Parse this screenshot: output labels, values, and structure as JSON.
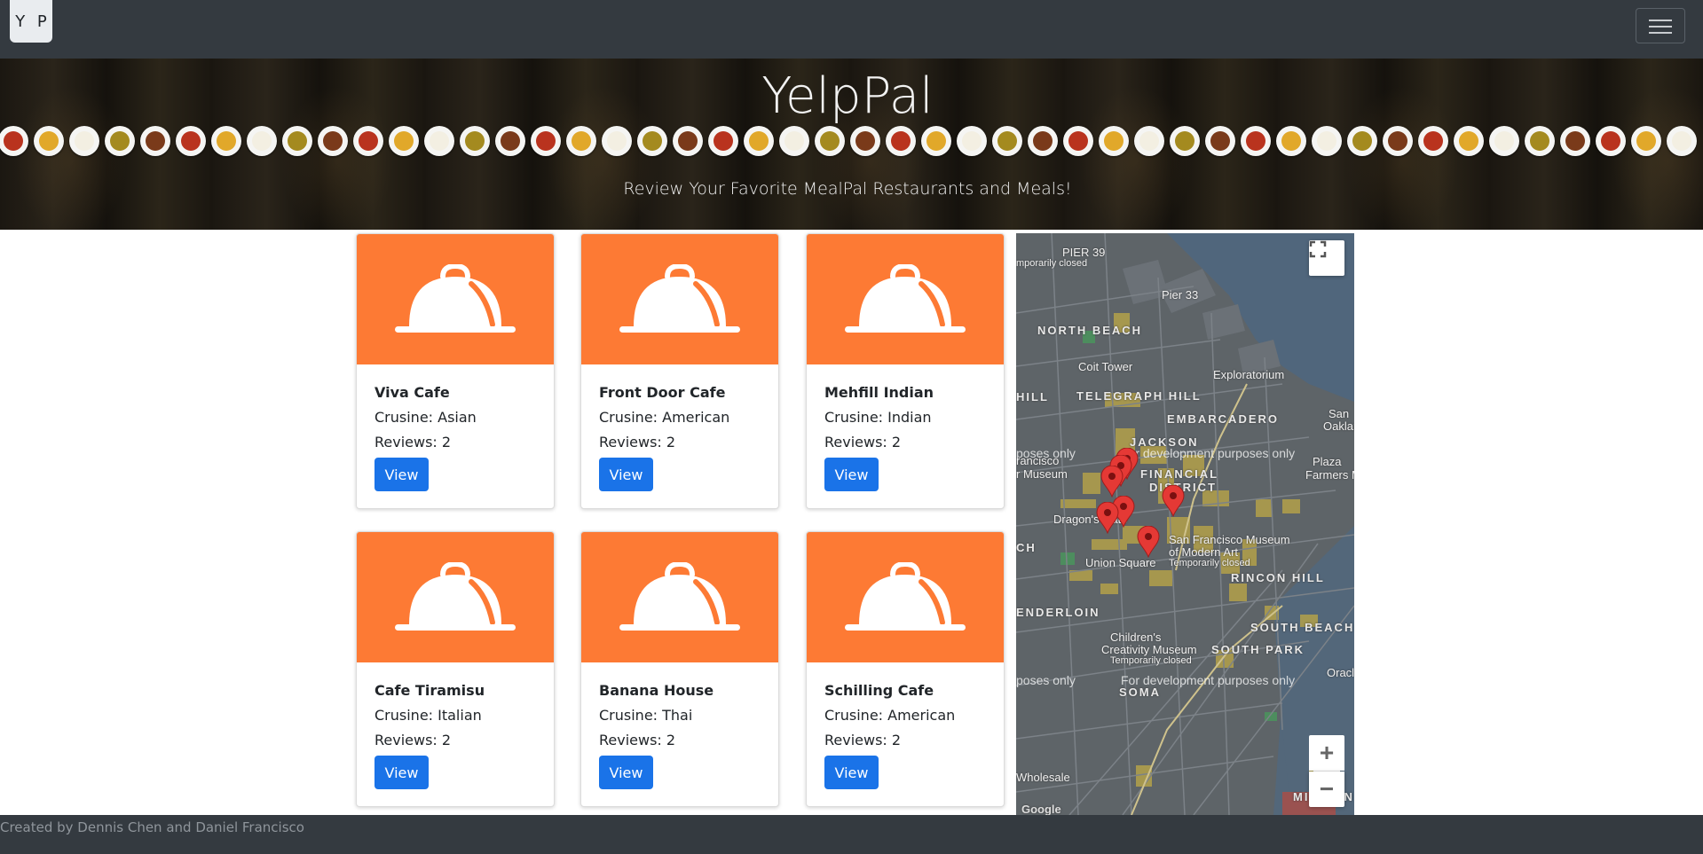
{
  "navbar": {
    "brand": "Y P"
  },
  "hero": {
    "title": "YelpPal",
    "subtitle": "Review Your Favorite MealPal Restaurants and Meals!"
  },
  "restaurants": [
    {
      "name": "Viva Cafe",
      "cuisine": "Crusine: Asian",
      "reviews": "Reviews: 2",
      "button": "View"
    },
    {
      "name": "Front Door Cafe",
      "cuisine": "Crusine: American",
      "reviews": "Reviews: 2",
      "button": "View"
    },
    {
      "name": "Mehfill Indian",
      "cuisine": "Crusine: Indian",
      "reviews": "Reviews: 2",
      "button": "View"
    },
    {
      "name": "Cafe Tiramisu",
      "cuisine": "Crusine: Italian",
      "reviews": "Reviews: 2",
      "button": "View"
    },
    {
      "name": "Banana House",
      "cuisine": "Crusine: Thai",
      "reviews": "Reviews: 2",
      "button": "View"
    },
    {
      "name": "Schilling Cafe",
      "cuisine": "Crusine: American",
      "reviews": "Reviews: 2",
      "button": "View"
    }
  ],
  "map": {
    "labels": {
      "pier39": "PIER 39",
      "pier39_sub": "mporarily closed",
      "pier33": "Pier 33",
      "north_beach": "NORTH BEACH",
      "coit_tower": "Coit Tower",
      "exploratorium": "Exploratorium",
      "hill": "HILL",
      "telegraph_hill": "TELEGRAPH HILL",
      "embarcadero": "EMBARCADERO",
      "san": "San",
      "oakland": "Oakland",
      "jackson": "JACKSON",
      "financial": "FINANCIAL",
      "district": "DISTRICT",
      "francisco": "rancisco",
      "museum": "r Museum",
      "plaza": "Plaza",
      "farmers": "Farmers Mark",
      "dragons_gate": "Dragon's Gate",
      "union_square": "Union Square",
      "sfmoma": "San Francisco Museum",
      "sfmoma2": "of Modern Art",
      "sfmoma3": "Temporarily closed",
      "ch": "CH",
      "rincon_hill": "RINCON HILL",
      "tenderloin": "ENDERLOIN",
      "south_beach": "SOUTH BEACH",
      "childrens": "Children's",
      "creativity": "Creativity Museum",
      "creativity_sub": "Temporarily closed",
      "south_park": "SOUTH PARK",
      "soma": "SOMA",
      "oracle": "Oracle",
      "wholesale": "Wholesale",
      "mission": "MISSION",
      "google": "Google"
    },
    "dev_text": "For development purposes only",
    "dev_text_partial": "poses only",
    "zoom_in": "+",
    "zoom_out": "−"
  },
  "footer": {
    "credit": "Created by Dennis Chen and Daniel Francisco"
  },
  "colors": {
    "navbar": "#343a40",
    "card_image": "#fd7a34",
    "button": "#1a73e8",
    "pin": "#e53935"
  },
  "icons": {
    "card_image": "cloche-icon",
    "fullscreen": "fullscreen-icon",
    "menu": "hamburger-icon",
    "marker": "map-pin-icon"
  }
}
